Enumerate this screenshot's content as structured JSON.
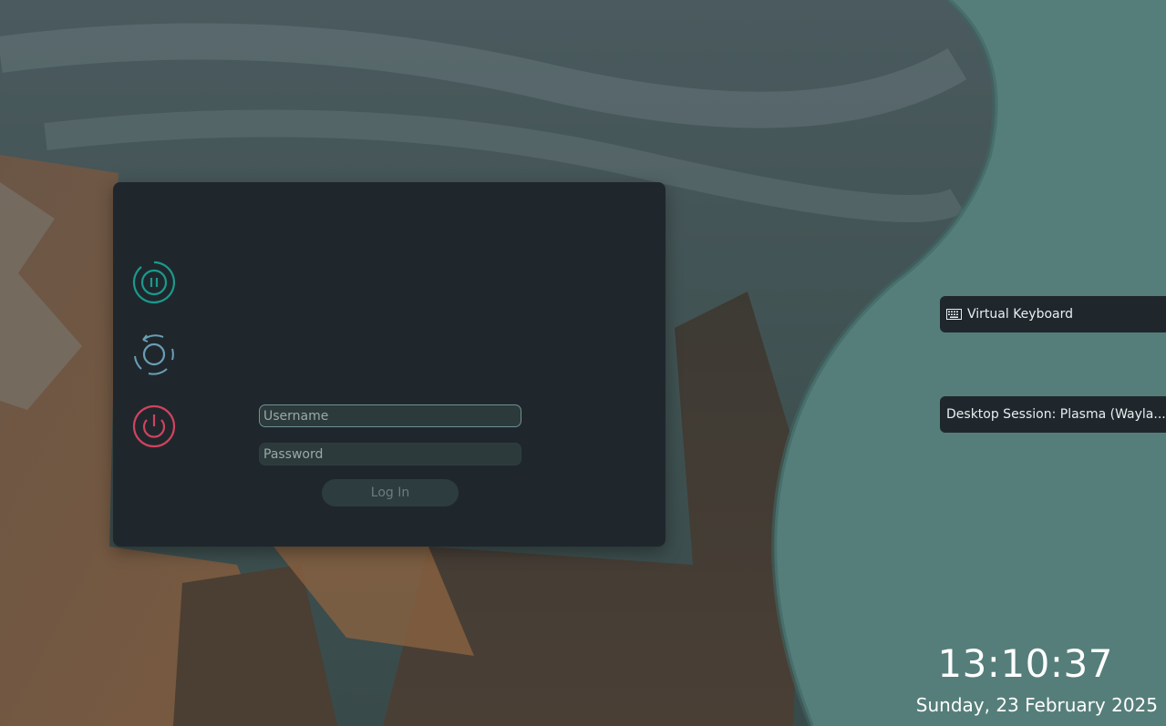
{
  "power": {
    "suspend": "suspend-icon",
    "restart": "restart-icon",
    "shutdown": "shutdown-icon"
  },
  "login": {
    "username_placeholder": "Username",
    "password_placeholder": "Password",
    "login_label": "Log In"
  },
  "side": {
    "virtual_keyboard_label": "Virtual Keyboard",
    "session_label": "Desktop Session: Plasma (Wayla..."
  },
  "clock": {
    "time": "13:10:37",
    "date": "Sunday, 23 February 2025"
  },
  "colors": {
    "accent": "#1a9a8c",
    "shutdown": "#d0435d",
    "panel": "#1f272d",
    "teal_bg": "#557e7a"
  }
}
